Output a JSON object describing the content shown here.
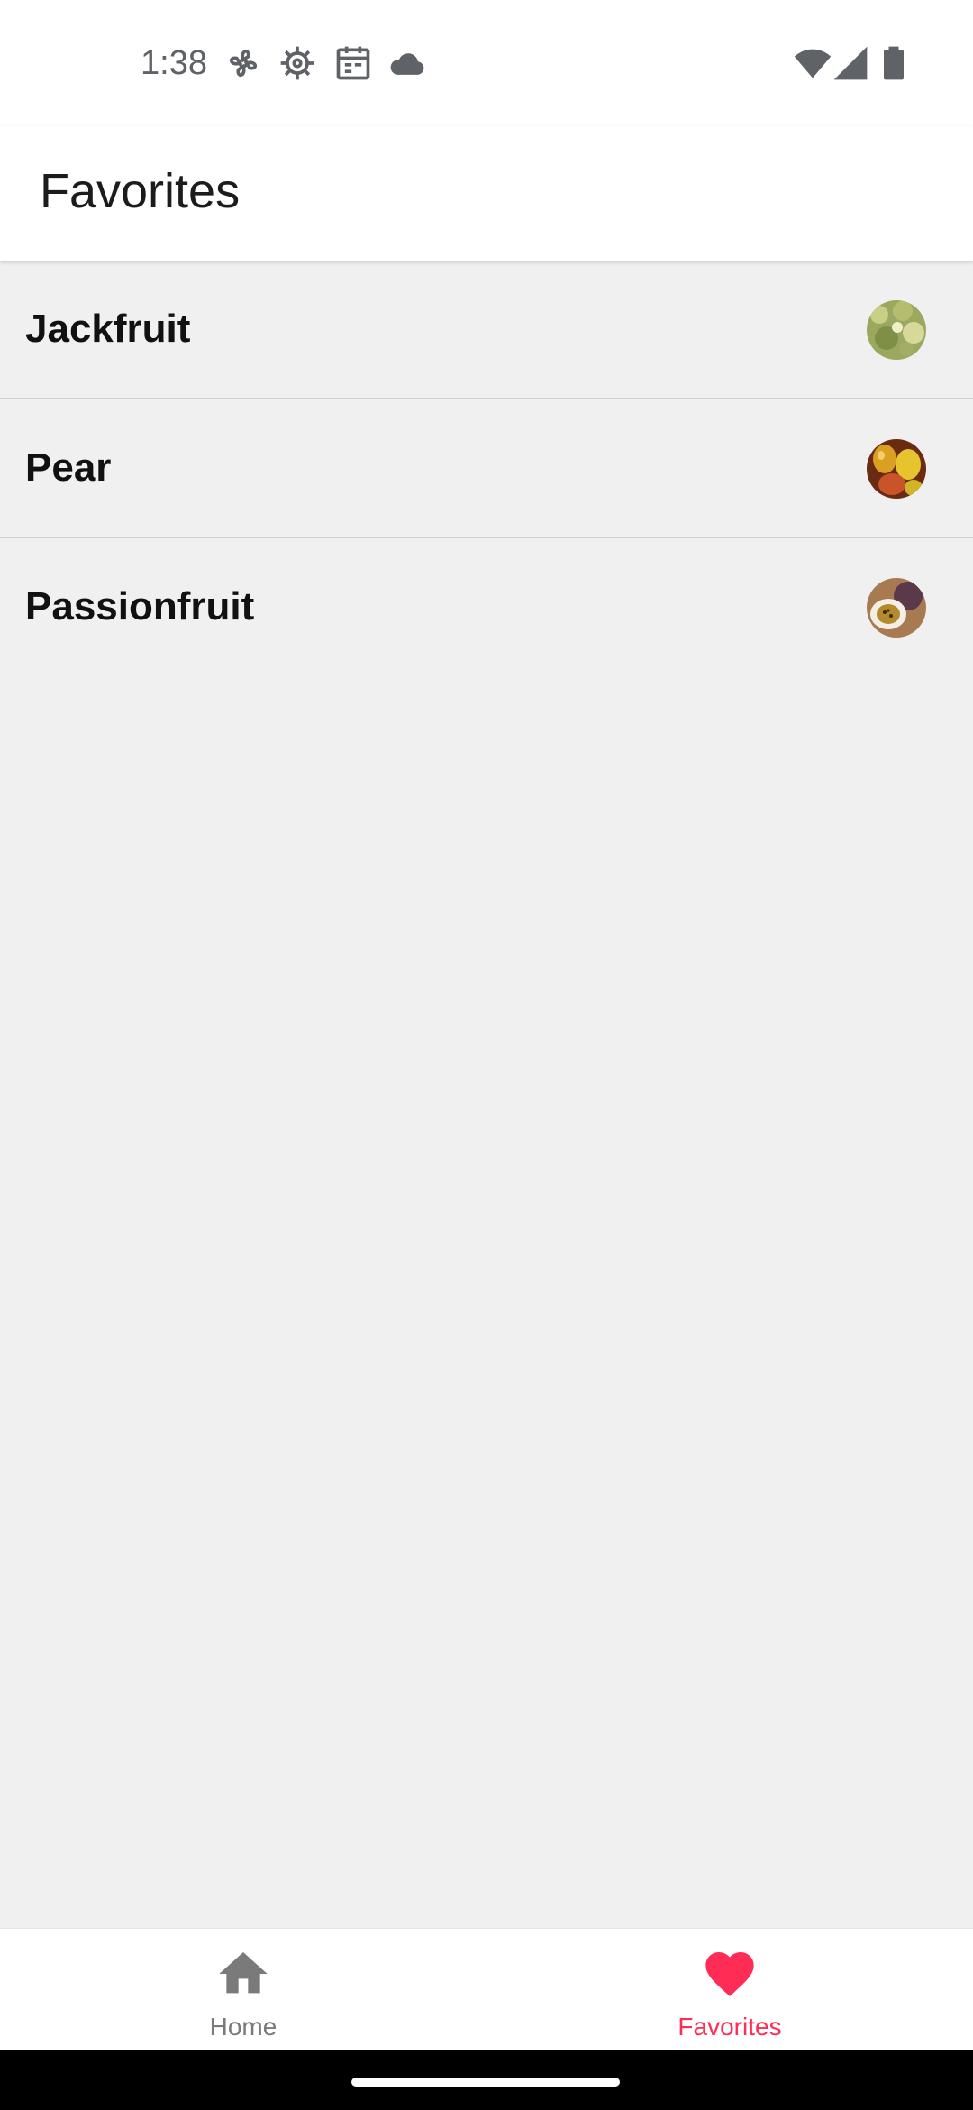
{
  "status_bar": {
    "time": "1:38",
    "icons": [
      "fan-icon",
      "gear-icon",
      "calendar-icon",
      "cloud-icon",
      "wifi-icon",
      "signal-icon",
      "battery-icon"
    ]
  },
  "app_bar": {
    "title": "Favorites"
  },
  "favorites": {
    "items": [
      {
        "label": "Jackfruit",
        "image": "jackfruit-thumbnail"
      },
      {
        "label": "Pear",
        "image": "pear-thumbnail"
      },
      {
        "label": "Passionfruit",
        "image": "passionfruit-thumbnail"
      }
    ]
  },
  "bottom_nav": {
    "home": {
      "label": "Home",
      "icon": "home-icon",
      "selected": false
    },
    "favorites": {
      "label": "Favorites",
      "icon": "heart-icon",
      "selected": true
    }
  },
  "colors": {
    "accent": "#ff2d55",
    "inactive": "#7a7a7a",
    "background": "#f0f0f0",
    "surface": "#ffffff"
  }
}
